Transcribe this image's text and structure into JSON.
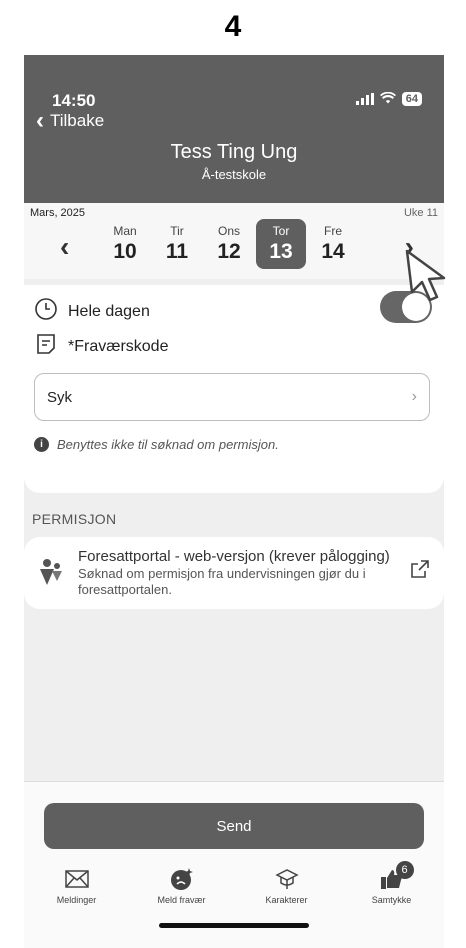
{
  "step": "4",
  "status": {
    "time": "14:50",
    "battery": "64"
  },
  "header": {
    "back_label": "Tilbake",
    "name": "Tess Ting Ung",
    "school": "Å-testskole"
  },
  "week": {
    "month": "Mars, 2025",
    "week_label": "Uke 11",
    "days": [
      {
        "name": "Man",
        "date": "10"
      },
      {
        "name": "Tir",
        "date": "11"
      },
      {
        "name": "Ons",
        "date": "12"
      },
      {
        "name": "Tor",
        "date": "13"
      },
      {
        "name": "Fre",
        "date": "14"
      }
    ],
    "selected_index": 3
  },
  "form": {
    "full_day_label": "Hele dagen",
    "full_day_on": true,
    "code_label": "*Fraværskode",
    "code_value": "Syk",
    "note": "Benyttes ikke til søknad om permisjon."
  },
  "permisjon": {
    "section_label": "PERMISJON",
    "title": "Foresattportal - web-versjon (krever pålogging)",
    "description": "Søknad om permisjon fra undervisningen gjør du i foresattportalen."
  },
  "send_label": "Send",
  "tabs": [
    {
      "label": "Meldinger",
      "icon": "envelope-icon"
    },
    {
      "label": "Meld fravær",
      "icon": "report-absence-icon"
    },
    {
      "label": "Karakterer",
      "icon": "graduation-cap-icon"
    },
    {
      "label": "Samtykke",
      "icon": "thumbs-up-icon",
      "badge": "6"
    }
  ],
  "colors": {
    "header": "#5f5f5f",
    "accent": "#5f5f5f",
    "background": "#efefef"
  }
}
